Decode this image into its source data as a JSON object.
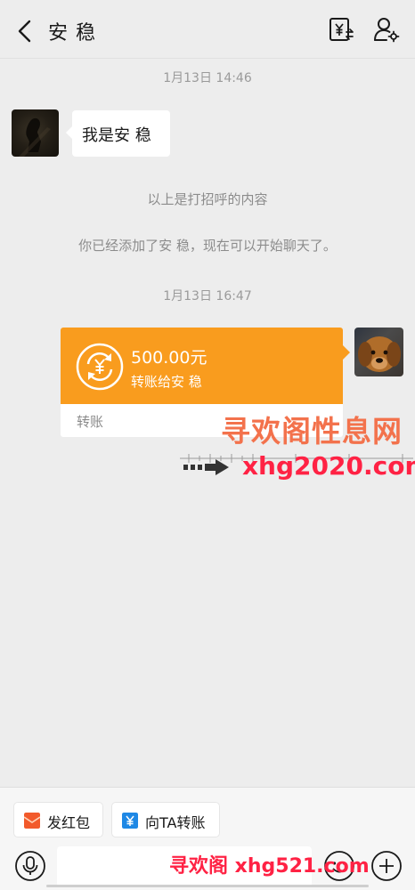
{
  "header": {
    "title": "安 稳",
    "back_icon": "chevron-left-icon",
    "transfer_icon": "yuan-transfer-icon",
    "profile_icon": "person-settings-icon"
  },
  "messages": {
    "time1": "1月13日 14:46",
    "greeting": "我是安 稳",
    "sys1": "以上是打招呼的内容",
    "sys2": "你已经添加了安 稳，现在可以开始聊天了。",
    "time2": "1月13日 16:47",
    "transfer": {
      "amount": "500.00元",
      "desc": "转账给安 稳",
      "footer": "转账",
      "accent": "#f99c1e"
    }
  },
  "watermarks": {
    "site_cn": "寻欢阁性息网",
    "site_url": "xhg2020.com",
    "bottom": "寻欢阁 xhg521.com"
  },
  "bottom": {
    "red_packet_label": "发红包",
    "transfer_label": "向TA转账",
    "input_placeholder": "",
    "red_packet_color": "#f25a2b",
    "transfer_chip_color": "#1e88e5"
  }
}
